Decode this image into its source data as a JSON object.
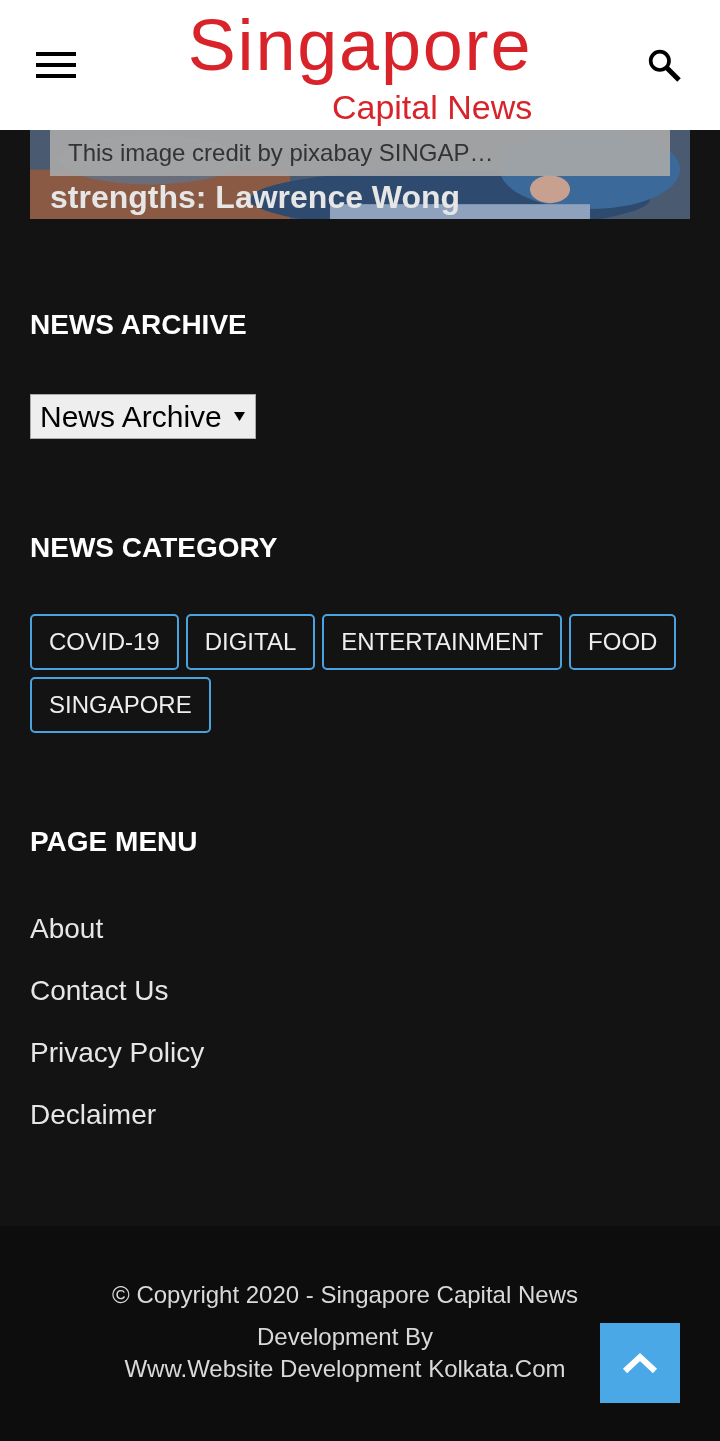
{
  "header": {
    "logo_title": "Singapore",
    "logo_subtitle": "Capital News"
  },
  "featured": {
    "kind": "picture",
    "caption": "This image credit by pixabay SINGAP…",
    "title": "strengths: Lawrence Wong"
  },
  "archive": {
    "heading": "NEWS ARCHIVE",
    "select": "News Archive"
  },
  "category": {
    "heading": "NEWS CATEGORY",
    "tags": [
      "COVID-19",
      "DIGITAL",
      "ENTERTAINMENT",
      "FOOD",
      "SINGAPORE"
    ]
  },
  "page_menu": {
    "heading": "PAGE MENU",
    "links": [
      "About",
      "Contact Us",
      "Privacy Policy",
      "Declaimer"
    ]
  },
  "footer": {
    "copyright": "© Copyright 2020 - Singapore Capital News",
    "credit_line_1": "Development By",
    "credit_line_2": "Www.Website Development Kolkata.Com"
  }
}
